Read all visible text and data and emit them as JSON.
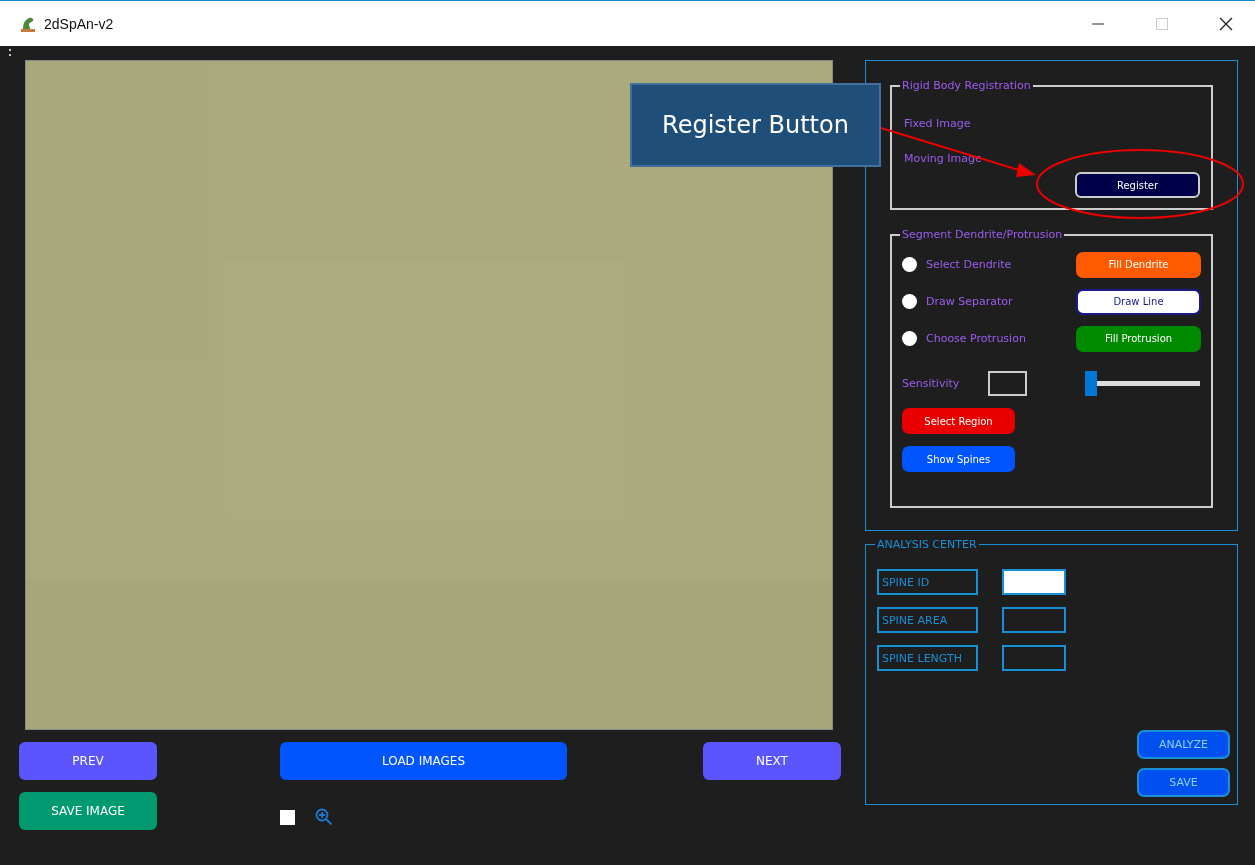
{
  "window": {
    "title": "2dSpAn-v2"
  },
  "navigation": {
    "prev": "PREV",
    "load": "LOAD IMAGES",
    "next": "NEXT",
    "save_image": "SAVE IMAGE",
    "zoom_toggle": {
      "checked": false
    }
  },
  "registration": {
    "title": "Rigid Body Registration",
    "fixed_label": "Fixed Image",
    "moving_label": "Moving Image",
    "button": "Register"
  },
  "segmentation": {
    "title": "Segment Dendrite/Protrusion",
    "options": [
      {
        "label": "Select Dendrite",
        "selected": false,
        "button": "Fill Dendrite",
        "kind": "solid",
        "color": "#ff5a00"
      },
      {
        "label": "Draw Separator",
        "selected": false,
        "button": "Draw Line",
        "kind": "outline",
        "color": "#ffffff"
      },
      {
        "label": "Choose Protrusion",
        "selected": false,
        "button": "Fill Protrusion",
        "kind": "solid",
        "color": "#008a00"
      }
    ],
    "sensitivity": {
      "label": "Sensitivity",
      "level": 0.05
    },
    "actions": [
      {
        "label": "Select Region",
        "color": "#e80000"
      },
      {
        "label": "Show Spines",
        "color": "#0055ff"
      }
    ]
  },
  "analysis": {
    "title": "ANALYSIS CENTER",
    "fields": [
      {
        "label": "SPINE ID",
        "active": true
      },
      {
        "label": "SPINE AREA",
        "active": false
      },
      {
        "label": "SPINE LENGTH",
        "active": false
      }
    ],
    "buttons": [
      "ANALYZE",
      "SAVE"
    ]
  },
  "annotation": {
    "text": "Register Button"
  }
}
